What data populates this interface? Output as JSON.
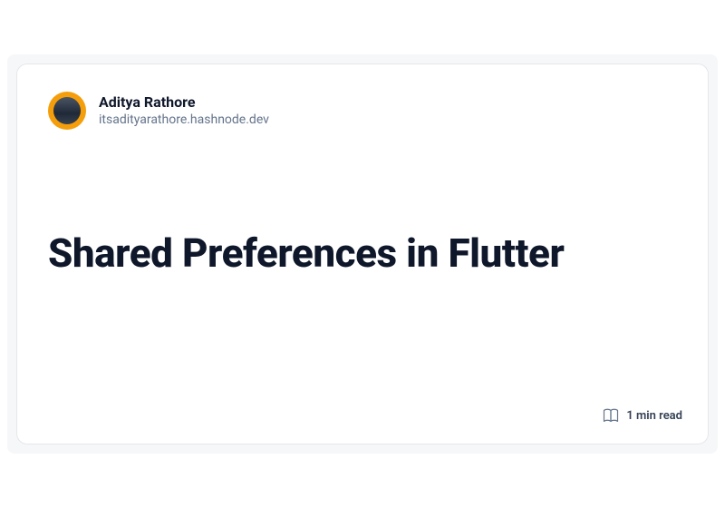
{
  "author": {
    "name": "Aditya Rathore",
    "domain": "itsadityarathore.hashnode.dev"
  },
  "post": {
    "title": "Shared Preferences in Flutter",
    "read_time": "1 min read"
  }
}
